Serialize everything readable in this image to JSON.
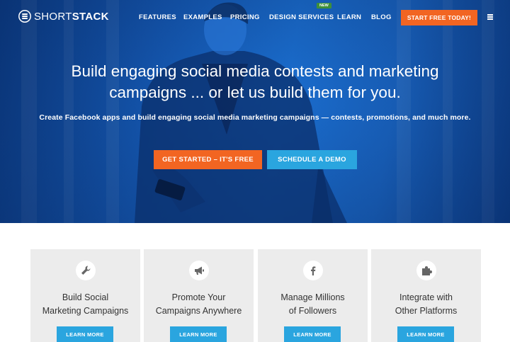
{
  "brand": {
    "name_thin": "SHORT",
    "name_bold": "STACK"
  },
  "nav": {
    "items": [
      "FEATURES",
      "EXAMPLES",
      "PRICING",
      "DESIGN SERVICES",
      "LEARN",
      "BLOG"
    ],
    "new_badge": "NEW",
    "cta": "START FREE TODAY!"
  },
  "hero": {
    "headline_line1": "Build engaging social media contests and marketing",
    "headline_line2": "campaigns ... or let us build them for you.",
    "subline": "Create Facebook apps and build engaging social media marketing campaigns — contests, promotions, and much more.",
    "primary_button": "GET STARTED – IT'S FREE",
    "secondary_button": "SCHEDULE A DEMO"
  },
  "features": [
    {
      "icon": "wrench-icon",
      "line1": "Build Social",
      "line2": "Marketing Campaigns",
      "button": "LEARN MORE"
    },
    {
      "icon": "megaphone-icon",
      "line1": "Promote Your",
      "line2": "Campaigns Anywhere",
      "button": "LEARN MORE"
    },
    {
      "icon": "facebook-icon",
      "line1": "Manage Millions",
      "line2": "of Followers",
      "button": "LEARN MORE"
    },
    {
      "icon": "puzzle-icon",
      "line1": "Integrate with",
      "line2": "Other Platforms",
      "button": "LEARN MORE"
    }
  ],
  "colors": {
    "accent_orange": "#f26522",
    "accent_blue": "#2aa5df",
    "hero_blue": "#1b6fd1",
    "card_bg": "#ececec"
  }
}
